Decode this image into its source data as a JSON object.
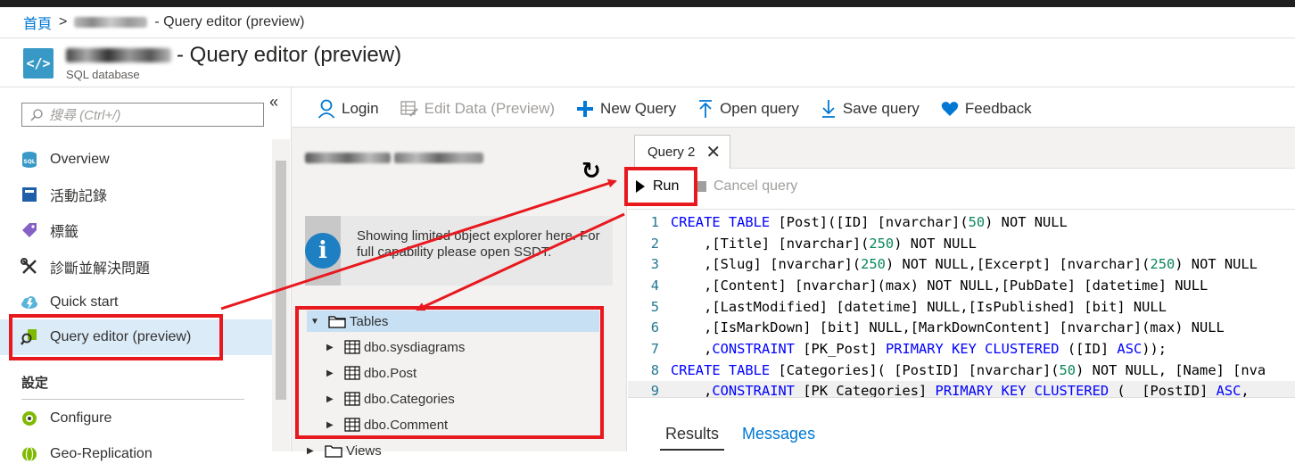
{
  "breadcrumb": {
    "home": "首頁",
    "separator": ">",
    "current_suffix": "- Query editor (preview)"
  },
  "resource": {
    "icon": "</>",
    "title_suffix": "- Query editor (preview)",
    "subtitle": "SQL database"
  },
  "sidebar": {
    "collapse_glyph": "«",
    "search_placeholder": "搜尋 (Ctrl+/)",
    "items": [
      {
        "label": "Overview",
        "icon": "sql-database-icon"
      },
      {
        "label": "活動記錄",
        "icon": "activity-log-icon"
      },
      {
        "label": "標籤",
        "icon": "tag-icon"
      },
      {
        "label": "診斷並解決問題",
        "icon": "wrench-icon"
      },
      {
        "label": "Quick start",
        "icon": "cloud-lightning-icon"
      },
      {
        "label": "Query editor (preview)",
        "icon": "query-editor-icon",
        "selected": true
      }
    ],
    "section": "設定",
    "section_items": [
      {
        "label": "Configure",
        "icon": "configure-icon"
      },
      {
        "label": "Geo-Replication",
        "icon": "globe-icon"
      }
    ]
  },
  "toolbar": {
    "login": "Login",
    "edit_data": "Edit Data (Preview)",
    "new_query": "New Query",
    "open_query": "Open query",
    "save_query": "Save query",
    "feedback": "Feedback"
  },
  "object_explorer": {
    "info_text": "Showing limited object explorer here. For full capability please open SSDT.",
    "tables_label": "Tables",
    "tables": [
      "dbo.sysdiagrams",
      "dbo.Post",
      "dbo.Categories",
      "dbo.Comment"
    ],
    "views_label": "Views"
  },
  "editor": {
    "tab_label": "Query 2",
    "run_label": "Run",
    "cancel_label": "Cancel query",
    "lines": [
      {
        "n": "1",
        "html": "<span class='kw'>CREATE TABLE</span> [Post]([ID] [nvarchar](<span class='num'>50</span>) NOT NULL"
      },
      {
        "n": "2",
        "html": "    ,[Title] [nvarchar](<span class='num'>250</span>) NOT NULL"
      },
      {
        "n": "3",
        "html": "    ,[Slug] [nvarchar](<span class='num'>250</span>) NOT NULL,[Excerpt] [nvarchar](<span class='num'>250</span>) NOT NULL"
      },
      {
        "n": "4",
        "html": "    ,[Content] [nvarchar](max) NOT NULL,[PubDate] [datetime] NULL"
      },
      {
        "n": "5",
        "html": "    ,[LastModified] [datetime] NULL,[IsPublished] [bit] NULL"
      },
      {
        "n": "6",
        "html": "    ,[IsMarkDown] [bit] NULL,[MarkDownContent] [nvarchar](max) NULL"
      },
      {
        "n": "7",
        "html": "    ,<span class='kw'>CONSTRAINT</span> [PK_Post] <span class='kw'>PRIMARY KEY CLUSTERED</span> ([ID] <span class='kw'>ASC</span>));"
      },
      {
        "n": "8",
        "html": "<span class='kw'>CREATE TABLE</span> [Categories]( [PostID] [nvarchar](<span class='num'>50</span>) NOT NULL, [Name] [nva"
      },
      {
        "n": "9",
        "html": "    ,<span class='kw'>CONSTRAINT</span> [PK_Categories] <span class='kw'>PRIMARY KEY CLUSTERED</span> (  [PostID] <span class='kw'>ASC</span>,"
      }
    ],
    "result_tabs": [
      "Results",
      "Messages"
    ]
  },
  "colors": {
    "accent": "#0078d4",
    "annotation_red": "#e8191e",
    "selected_bg": "#dcebf8"
  }
}
